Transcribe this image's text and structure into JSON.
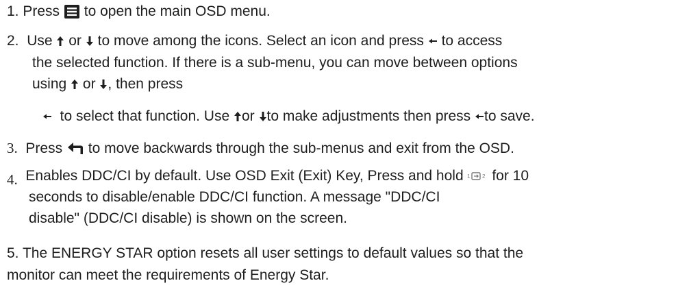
{
  "steps": {
    "s1": {
      "num": "1.",
      "a": "Press",
      "b": "to open the main OSD menu.",
      "menu_icon": "menu-button-icon"
    },
    "s2": {
      "num": "2.",
      "l1a": "Use",
      "l1b": "or",
      "l1c": "to move among the icons. Select an icon and press",
      "l1d": "to access",
      "l2": "the selected function. If there is a sub-menu, you can move between options",
      "l3a": "using",
      "l3b": "or",
      "l3c": ", then press",
      "l4a": "to select that function. Use",
      "l4b": "or",
      "l4c": "to make adjustments then press",
      "l4d": "to save.",
      "up_icon": "arrow-up-icon",
      "down_icon": "arrow-down-icon",
      "enter_icon": "enter-icon"
    },
    "s3": {
      "num": "3.",
      "a": "Press",
      "b": "to move backwards through the sub-menus and exit from the OSD.",
      "back_icon": "back-arrow-icon"
    },
    "s4": {
      "num": "4.",
      "l1a": "Enables DDC/CI by default. Use OSD Exit (Exit) Key, Press and hold",
      "l1b": "for 10",
      "l2": "seconds to disable/enable DDC/CI function. A message \"DDC/CI",
      "l3": "disable\" (DDC/CI disable) is shown on the screen.",
      "input_icon": "input-switch-icon"
    },
    "s5": {
      "l1": "5.  The ENERGY STAR option resets all user settings to default values so that the",
      "l2": "monitor  can meet the requirements of Energy Star."
    }
  }
}
